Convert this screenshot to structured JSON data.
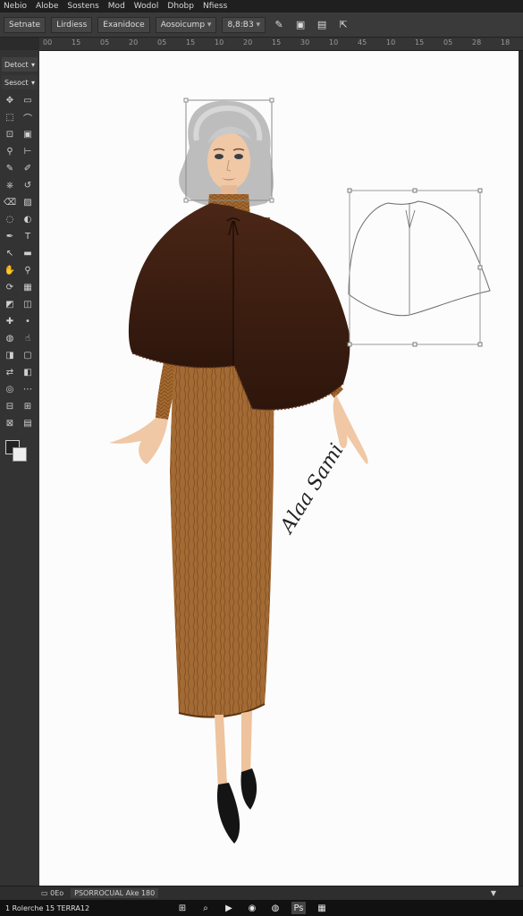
{
  "menubar": {
    "items": [
      "Nebio",
      "Alobe",
      "Sostens",
      "Mod",
      "Wodol",
      "Dhobp",
      "Nfiess"
    ]
  },
  "options": {
    "workspace": "Setnate",
    "lines": "Lirdiess",
    "mode": "Exanidoce",
    "appearance": "Aosoicump",
    "value": "8,8:B3"
  },
  "ruler": {
    "ticks": [
      "00",
      "15",
      "05",
      "20",
      "05",
      "15",
      "10",
      "20",
      "15",
      "30",
      "10",
      "45",
      "10",
      "15",
      "05",
      "28",
      "18"
    ]
  },
  "toolbar": {
    "header": "Detoct",
    "subheader": "Sesoct",
    "tool_count": 40
  },
  "canvas": {
    "signature": "Alaa Sami"
  },
  "status": {
    "zoom": "0Eo",
    "info": "PSORROCUAL Ake 180"
  },
  "taskbar": {
    "text": "1 Rolerche 15 TERRA12"
  },
  "colors": {
    "app_bg": "#2b2b2b",
    "menubar": "#1f1f1f",
    "panel": "#3a3a3a",
    "canvas": "#fcfcfc",
    "cape": "#3e1f12",
    "dress": "#a36a34",
    "hair": "#c9c9c9",
    "shoes": "#141414",
    "selection": "#7a7a7a"
  },
  "icons": {
    "toolbar": [
      "move-icon",
      "artboard-icon",
      "marquee-icon",
      "lasso-icon",
      "crop-icon",
      "frame-icon",
      "eyedropper-icon",
      "ruler-icon",
      "brush-icon",
      "pencil-icon",
      "stamp-icon",
      "history-brush-icon",
      "eraser-icon",
      "gradient-icon",
      "blur-icon",
      "dodge-icon",
      "pen-icon",
      "type-icon",
      "path-select-icon",
      "shape-icon",
      "hand-icon",
      "zoom-icon",
      "rotate-icon",
      "grid-icon",
      "slice-icon",
      "patch-icon",
      "heal-icon",
      "spot-icon",
      "sponge-icon",
      "smudge-icon",
      "mask-icon",
      "screen-mode-icon",
      "swap-icon",
      "default-colors-icon",
      "quick-mask-icon",
      "edit-toolbar-icon",
      "extra-a-icon",
      "extra-b-icon",
      "extra-c-icon",
      "extra-d-icon"
    ],
    "taskbar": [
      "windows-start-icon",
      "search-icon",
      "play-icon",
      "chrome-icon",
      "firefox-icon",
      "photoshop-icon",
      "apps-icon"
    ]
  }
}
